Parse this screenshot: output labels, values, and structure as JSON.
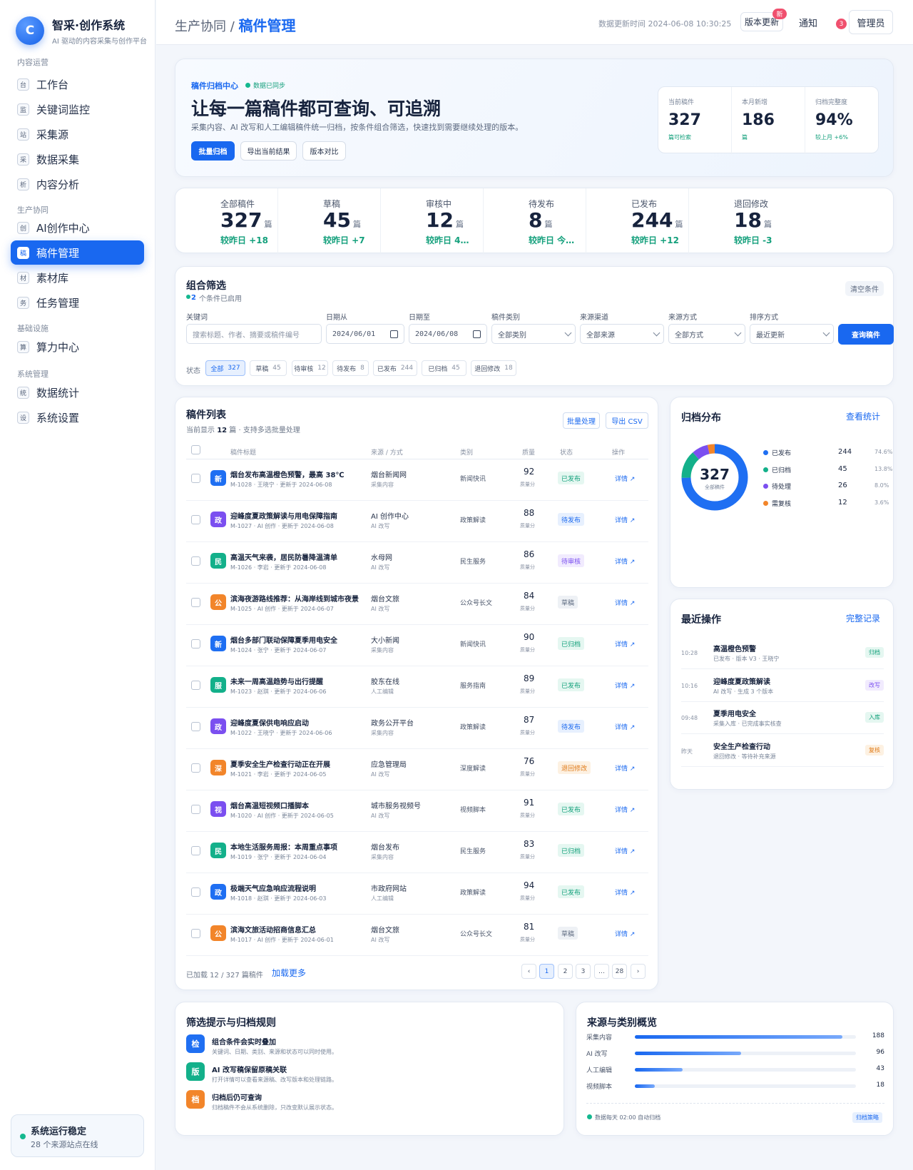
{
  "app": {
    "name": "智采·创作系统",
    "subtitle": "AI 驱动的内容采集与创作平台",
    "logo_letter": "C",
    "accent": "#1968f0"
  },
  "sidebar": {
    "groups": [
      {
        "label": "内容运营",
        "items": [
          {
            "icon": "台",
            "label": "工作台"
          },
          {
            "icon": "监",
            "label": "关键词监控"
          },
          {
            "icon": "站",
            "label": "采集源"
          },
          {
            "icon": "采",
            "label": "数据采集"
          },
          {
            "icon": "析",
            "label": "内容分析"
          }
        ]
      },
      {
        "label": "生产协同",
        "items": [
          {
            "icon": "创",
            "label": "AI创作中心"
          },
          {
            "icon": "稿",
            "label": "稿件管理",
            "active": true
          },
          {
            "icon": "材",
            "label": "素材库"
          },
          {
            "icon": "务",
            "label": "任务管理"
          }
        ]
      },
      {
        "label": "基础设施",
        "items": [
          {
            "icon": "算",
            "label": "算力中心"
          }
        ]
      },
      {
        "label": "系统管理",
        "items": [
          {
            "icon": "统",
            "label": "数据统计"
          },
          {
            "icon": "设",
            "label": "系统设置"
          }
        ]
      }
    ],
    "status": {
      "title": "系统运行稳定",
      "subtitle": "28 个来源站点在线"
    }
  },
  "topbar": {
    "crumb_parent": "生产协同 /",
    "crumb_current": "稿件管理",
    "update_time": "数据更新时间 2024-06-08 10:30:25",
    "version_btn": "版本更新",
    "version_badge": "新",
    "notice": "通知",
    "notice_count": "3",
    "admin": "管理员"
  },
  "hero": {
    "tag": "稿件归档中心",
    "sync": "数据已同步",
    "title": "让每一篇稿件都可查询、可追溯",
    "desc": "采集内容、AI 改写和人工编辑稿件统一归档，按条件组合筛选，快速找到需要继续处理的版本。",
    "buttons": [
      "批量归档",
      "导出当前结果",
      "版本对比"
    ],
    "stats": [
      {
        "label": "当前稿件",
        "value": "327",
        "sub": "篇可检索"
      },
      {
        "label": "本月新增",
        "value": "186",
        "sub": "篇"
      },
      {
        "label": "归档完整度",
        "value": "94%",
        "sub": "较上月 +6%"
      }
    ]
  },
  "stats": [
    {
      "label": "全部稿件",
      "value": "327",
      "unit": "篇",
      "delta": "较昨日 +18",
      "icon": "document-icon"
    },
    {
      "label": "草稿",
      "value": "45",
      "unit": "篇",
      "delta": "较昨日 +7",
      "icon": "draft-icon"
    },
    {
      "label": "审核中",
      "value": "12",
      "unit": "篇",
      "delta": "较昨日 4…",
      "icon": "review-icon"
    },
    {
      "label": "待发布",
      "value": "8",
      "unit": "篇",
      "delta": "较昨日 今…",
      "icon": "pending-icon"
    },
    {
      "label": "已发布",
      "value": "244",
      "unit": "篇",
      "delta": "较昨日 +12",
      "icon": "publish-icon"
    },
    {
      "label": "退回修改",
      "value": "18",
      "unit": "篇",
      "delta": "较昨日 -3",
      "icon": "clipboard-icon"
    }
  ],
  "filter": {
    "title": "组合筛选",
    "enabled_count": "2",
    "enabled_text": "个条件已启用",
    "clear": "清空条件",
    "fields": [
      {
        "label": "关键词",
        "placeholder": "搜索标题、作者、摘要或稿件编号"
      },
      {
        "label": "日期从",
        "value": "2024/06/01"
      },
      {
        "label": "日期至",
        "value": "2024/06/08"
      },
      {
        "label": "稿件类别",
        "value": "全部类别"
      },
      {
        "label": "来源渠道",
        "value": "全部来源"
      },
      {
        "label": "来源方式",
        "value": "全部方式"
      },
      {
        "label": "排序方式",
        "value": "最近更新"
      }
    ],
    "search_btn": "查询稿件",
    "status_label": "状态",
    "chips": [
      {
        "label": "全部",
        "count": "327",
        "active": true
      },
      {
        "label": "草稿",
        "count": "45"
      },
      {
        "label": "待审核",
        "count": "12"
      },
      {
        "label": "待发布",
        "count": "8"
      },
      {
        "label": "已发布",
        "count": "244"
      },
      {
        "label": "已归档",
        "count": "45"
      },
      {
        "label": "退回修改",
        "count": "18"
      }
    ]
  },
  "list": {
    "title": "稿件列表",
    "sub_pre": "当前显示",
    "sub_count": "12",
    "sub_post": "篇 · 支持多选批量处理",
    "batch_btn": "批量处理",
    "export_btn": "导出 CSV",
    "columns": [
      "稿件标题",
      "来源 / 方式",
      "类别",
      "质量",
      "状态",
      "操作"
    ],
    "quality_label": "质量分",
    "op_label": "详情 ↗",
    "rows": [
      {
        "icon": "新",
        "color": "#1f6ff2",
        "title": "烟台发布高温橙色预警，最高 38℃",
        "meta": "M-1028 · 王晓宁 · 更新于 2024-06-08",
        "source": "烟台新闻网",
        "method": "采集内容",
        "category": "新闻快讯",
        "quality": "92",
        "status": "已发布"
      },
      {
        "icon": "政",
        "color": "#7b4ff0",
        "title": "迎峰度夏政策解读与用电保障指南",
        "meta": "M-1027 · AI 创作 · 更新于 2024-06-08",
        "source": "AI 创作中心",
        "method": "AI 改写",
        "category": "政策解读",
        "quality": "88",
        "status": "待发布"
      },
      {
        "icon": "民",
        "color": "#13b08a",
        "title": "高温天气来袭，居民防暑降温清单",
        "meta": "M-1026 · 李岩 · 更新于 2024-06-08",
        "source": "水母网",
        "method": "AI 改写",
        "category": "民生服务",
        "quality": "86",
        "status": "待审核"
      },
      {
        "icon": "公",
        "color": "#f2852a",
        "title": "滨海夜游路线推荐：从海岸线到城市夜景",
        "meta": "M-1025 · AI 创作 · 更新于 2024-06-07",
        "source": "烟台文旅",
        "method": "AI 改写",
        "category": "公众号长文",
        "quality": "84",
        "status": "草稿"
      },
      {
        "icon": "新",
        "color": "#1f6ff2",
        "title": "烟台多部门联动保障夏季用电安全",
        "meta": "M-1024 · 张宁 · 更新于 2024-06-07",
        "source": "大小新闻",
        "method": "采集内容",
        "category": "新闻快讯",
        "quality": "90",
        "status": "已归档"
      },
      {
        "icon": "服",
        "color": "#13b08a",
        "title": "未来一周高温趋势与出行提醒",
        "meta": "M-1023 · 赵琪 · 更新于 2024-06-06",
        "source": "胶东在线",
        "method": "人工编辑",
        "category": "服务指南",
        "quality": "89",
        "status": "已发布"
      },
      {
        "icon": "政",
        "color": "#7b4ff0",
        "title": "迎峰度夏保供电响应启动",
        "meta": "M-1022 · 王晓宁 · 更新于 2024-06-06",
        "source": "政务公开平台",
        "method": "采集内容",
        "category": "政策解读",
        "quality": "87",
        "status": "待发布"
      },
      {
        "icon": "深",
        "color": "#f2852a",
        "title": "夏季安全生产检查行动正在开展",
        "meta": "M-1021 · 李岩 · 更新于 2024-06-05",
        "source": "应急管理局",
        "method": "AI 改写",
        "category": "深度解读",
        "quality": "76",
        "status": "退回修改"
      },
      {
        "icon": "视",
        "color": "#7b4ff0",
        "title": "烟台高温短视频口播脚本",
        "meta": "M-1020 · AI 创作 · 更新于 2024-06-05",
        "source": "城市服务视频号",
        "method": "AI 改写",
        "category": "视频脚本",
        "quality": "91",
        "status": "已发布"
      },
      {
        "icon": "民",
        "color": "#13b08a",
        "title": "本地生活服务周报：本周重点事项",
        "meta": "M-1019 · 张宁 · 更新于 2024-06-04",
        "source": "烟台发布",
        "method": "采集内容",
        "category": "民生服务",
        "quality": "83",
        "status": "已归档"
      },
      {
        "icon": "政",
        "color": "#1f6ff2",
        "title": "极端天气应急响应流程说明",
        "meta": "M-1018 · 赵琪 · 更新于 2024-06-03",
        "source": "市政府网站",
        "method": "人工编辑",
        "category": "政策解读",
        "quality": "94",
        "status": "已发布"
      },
      {
        "icon": "公",
        "color": "#f2852a",
        "title": "滨海文旅活动招商信息汇总",
        "meta": "M-1017 · AI 创作 · 更新于 2024-06-01",
        "source": "烟台文旅",
        "method": "AI 改写",
        "category": "公众号长文",
        "quality": "81",
        "status": "草稿"
      }
    ],
    "status_styles": {
      "已发布": {
        "bg": "#e5f7f1",
        "fg": "#12a07a"
      },
      "待发布": {
        "bg": "#e7f0fe",
        "fg": "#1968f0"
      },
      "待审核": {
        "bg": "#f1ebfe",
        "fg": "#7b4ff0"
      },
      "草稿": {
        "bg": "#eef1f5",
        "fg": "#5d6a80"
      },
      "已归档": {
        "bg": "#e5f7f1",
        "fg": "#12a07a"
      },
      "退回修改": {
        "bg": "#fdf1e2",
        "fg": "#e07a17"
      }
    },
    "footer": "已加载 12 / 327 篇稿件",
    "load_more": "加载更多",
    "pages": [
      "‹",
      "1",
      "2",
      "3",
      "…",
      "28",
      "›"
    ]
  },
  "distribution": {
    "title": "归档分布",
    "link": "查看统计",
    "center_value": "327",
    "center_label": "全部稿件",
    "items": [
      {
        "label": "已发布",
        "value": 244,
        "pct": "74.6%",
        "color": "#1f6ff2"
      },
      {
        "label": "已归档",
        "value": 45,
        "pct": "13.8%",
        "color": "#13b08a"
      },
      {
        "label": "待处理",
        "value": 26,
        "pct": "8.0%",
        "color": "#7b4ff0"
      },
      {
        "label": "需复核",
        "value": 12,
        "pct": "3.6%",
        "color": "#f2852a"
      }
    ]
  },
  "recent": {
    "title": "最近操作",
    "link": "完整记录",
    "items": [
      {
        "time": "10:28",
        "title": "高温橙色预警",
        "sub": "已发布 · 版本 V3 · 王晓宁",
        "badge": "归档",
        "bg": "#e5f7f1",
        "fg": "#12a07a"
      },
      {
        "time": "10:16",
        "title": "迎峰度夏政策解读",
        "sub": "AI 改写 · 生成 3 个版本",
        "badge": "改写",
        "bg": "#f1ebfe",
        "fg": "#7b4ff0"
      },
      {
        "time": "09:48",
        "title": "夏季用电安全",
        "sub": "采集入库 · 已完成事实核查",
        "badge": "入库",
        "bg": "#e5f7f1",
        "fg": "#12a07a"
      },
      {
        "time": "昨天",
        "title": "安全生产检查行动",
        "sub": "退回修改 · 等待补充来源",
        "badge": "复核",
        "bg": "#fdf1e2",
        "fg": "#e07a17"
      }
    ]
  },
  "tips": {
    "title": "筛选提示与归档规则",
    "items": [
      {
        "icon": "检",
        "color": "#1f6ff2",
        "title": "组合条件会实时叠加",
        "sub": "关键词、日期、类别、来源和状态可以同时使用。"
      },
      {
        "icon": "版",
        "color": "#13b08a",
        "title": "AI 改写稿保留原稿关联",
        "sub": "打开详情可以查看来源稿、改写版本和处理链路。"
      },
      {
        "icon": "档",
        "color": "#f2852a",
        "title": "归档后仍可查询",
        "sub": "归档稿件不会从系统删除，只改变默认展示状态。"
      }
    ]
  },
  "sources": {
    "title": "来源与类别概览",
    "max": 200,
    "items": [
      {
        "label": "采集内容",
        "value": 188
      },
      {
        "label": "AI 改写",
        "value": 96
      },
      {
        "label": "人工编辑",
        "value": 43
      },
      {
        "label": "视频脚本",
        "value": 18
      }
    ],
    "footer": "数据每天 02:00 自动归档",
    "badge": "归档策略"
  }
}
